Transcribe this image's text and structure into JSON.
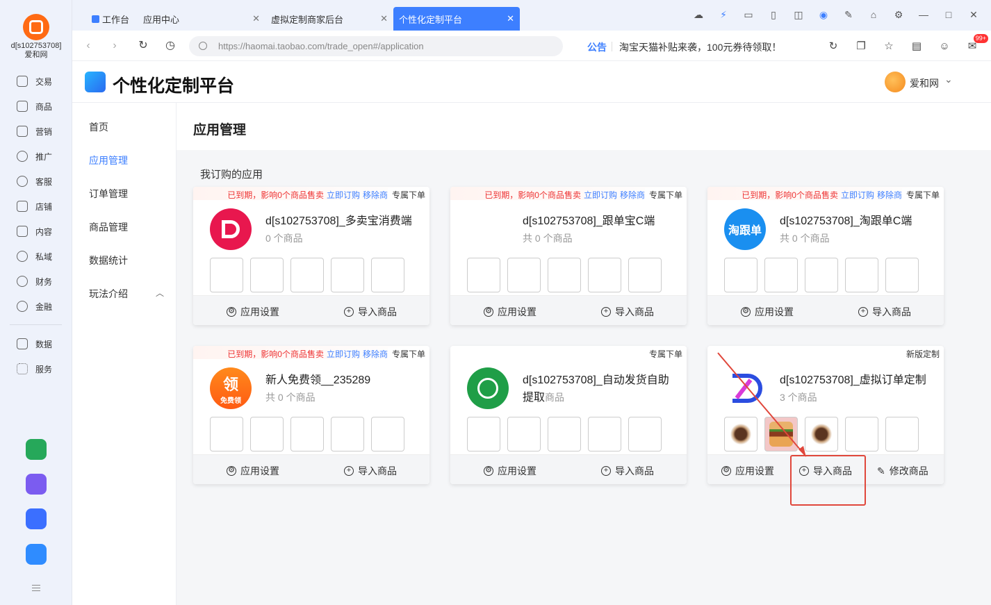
{
  "rail": {
    "account": "d[s102753708]\n爱和网",
    "items": [
      {
        "label": "交易",
        "icon": "trade-icon"
      },
      {
        "label": "商品",
        "icon": "goods-icon"
      },
      {
        "label": "营销",
        "icon": "marketing-icon"
      },
      {
        "label": "推广",
        "icon": "promote-icon"
      },
      {
        "label": "客服",
        "icon": "service-icon"
      },
      {
        "label": "店铺",
        "icon": "shop-icon"
      },
      {
        "label": "内容",
        "icon": "content-icon"
      },
      {
        "label": "私域",
        "icon": "private-icon"
      },
      {
        "label": "财务",
        "icon": "finance-icon"
      },
      {
        "label": "金融",
        "icon": "loan-icon"
      },
      {
        "label": "数据",
        "icon": "data-icon"
      },
      {
        "label": "服务",
        "icon": "apps-icon"
      }
    ]
  },
  "tabs": [
    {
      "label": "工作台"
    },
    {
      "label": "应用中心"
    },
    {
      "label": "虚拟定制商家后台"
    },
    {
      "label": "个性化定制平台"
    }
  ],
  "address": {
    "url": "https://haomai.taobao.com/trade_open#/application",
    "notice_tag": "公告",
    "notice": "淘宝天猫补贴来袭，100元券待领取！",
    "badge": "99+"
  },
  "header": {
    "title": "个性化定制平台",
    "user": "爱和网"
  },
  "menu": {
    "items": [
      "首页",
      "应用管理",
      "订单管理",
      "商品管理",
      "数据统计",
      "玩法介绍"
    ]
  },
  "main": {
    "title": "应用管理",
    "section": "我订购的应用"
  },
  "cards": [
    {
      "warn": "已到期，影响0个商品售卖",
      "renew": "立即订购",
      "remove": "移除商",
      "tag": "专属下单",
      "name": "d[s102753708]_多卖宝消费端",
      "count": "0 个商品",
      "settings": "应用设置",
      "import": "导入商品"
    },
    {
      "warn": "已到期，影响0个商品售卖",
      "renew": "立即订购",
      "remove": "移除商",
      "tag": "专属下单",
      "name": "d[s102753708]_跟单宝C端",
      "count": "共 0 个商品",
      "settings": "应用设置",
      "import": "导入商品"
    },
    {
      "warn": "已到期，影响0个商品售卖",
      "renew": "立即订购",
      "remove": "移除商",
      "tag": "专属下单",
      "name": "d[s102753708]_淘跟单C端",
      "count": "共 0 个商品",
      "icon_text": "淘跟单",
      "settings": "应用设置",
      "import": "导入商品"
    },
    {
      "warn": "已到期，影响0个商品售卖",
      "renew": "立即订购",
      "remove": "移除商",
      "tag": "专属下单",
      "name": "新人免费领__235289",
      "count": "共 0 个商品",
      "icon_text": "领",
      "icon_sub": "免费领",
      "settings": "应用设置",
      "import": "导入商品"
    },
    {
      "tag": "专属下单",
      "name": "d[s102753708]_自动发货自助提取",
      "count": "商品",
      "settings": "应用设置",
      "import": "导入商品"
    },
    {
      "tag": "新版定制",
      "name": "d[s102753708]_虚拟订单定制",
      "count": "3 个商品",
      "settings": "应用设置",
      "import": "导入商品",
      "edit": "修改商品"
    }
  ]
}
